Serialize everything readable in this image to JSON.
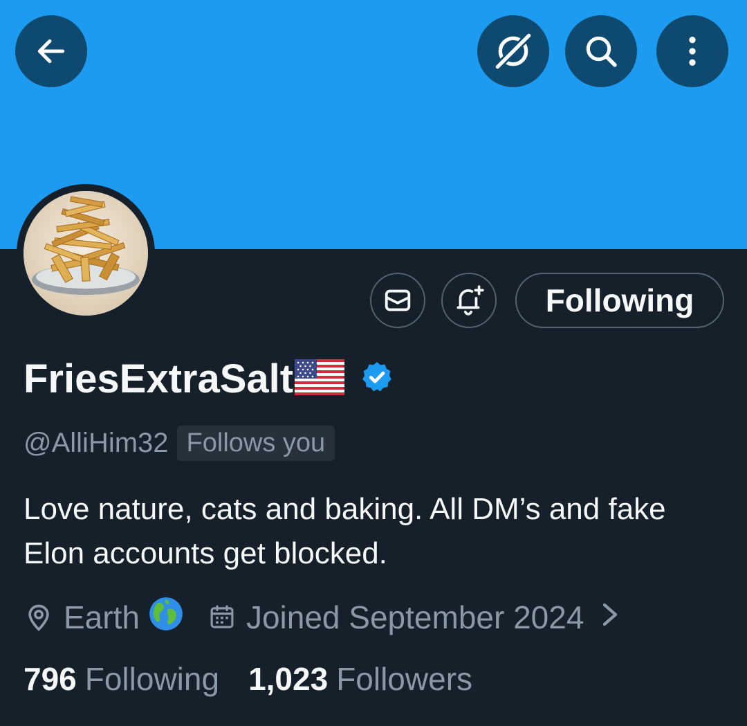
{
  "header": {
    "back_icon": "arrow-left-icon",
    "grok_icon": "grok-icon",
    "search_icon": "search-icon",
    "more_icon": "more-vertical-icon",
    "banner_color": "#1d9bf0",
    "button_color": "#0e4a70"
  },
  "profile": {
    "avatar_alt": "french-fries-avatar",
    "display_name": "FriesExtraSalt",
    "flag_emoji": "us-flag-icon",
    "verified_icon": "verified-badge-icon",
    "handle": "@AlliHim32",
    "follows_you": "Follows you",
    "bio": "Love nature, cats and baking. All DM’s and fake Elon accounts get blocked.",
    "location": "Earth",
    "location_icon": "location-pin-icon",
    "globe_icon": "globe-icon",
    "joined": "Joined September 2024",
    "joined_icon": "calendar-icon"
  },
  "actions": {
    "message_icon": "envelope-icon",
    "notify_icon": "bell-plus-icon",
    "following_label": "Following"
  },
  "stats": {
    "following_count": "796",
    "following_label": "Following",
    "followers_count": "1,023",
    "followers_label": "Followers"
  },
  "colors": {
    "background": "#15202b",
    "text_primary": "#f7f9f9",
    "text_secondary": "#8b98a5",
    "verified": "#1d9bf0"
  }
}
